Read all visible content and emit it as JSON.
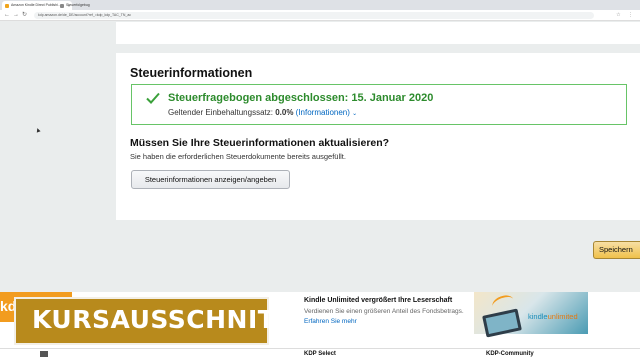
{
  "browser": {
    "tabs": [
      {
        "label": "Amazon Kindle Direct Publishi...",
        "active": true
      },
      {
        "label": "Steuerfolgebug"
      }
    ],
    "url": "kdp.amazon.de/de_DE/account?ref_=kdp_kdp_TAC_TN_ac"
  },
  "tax": {
    "section_title": "Steuerinformationen",
    "success_title": "Steuerfragebogen abgeschlossen: 15. Januar 2020",
    "rate_label": "Geltender Einbehaltungssatz:",
    "rate_value": "0.0%",
    "info_link": "(Informationen)",
    "question_title": "Müssen Sie Ihre Steuerinformationen aktualisieren?",
    "question_sub": "Sie haben die erforderlichen Steuerdokumente bereits ausgefüllt.",
    "button_label": "Steuerinformationen anzeigen/angeben"
  },
  "actions": {
    "save_label": "Speichern"
  },
  "promo": {
    "left_text": "kd",
    "ku_title": "Kindle Unlimited vergrößert Ihre Leserschaft",
    "ku_sub": "Verdienen Sie einen größeren Anteil des Fondsbetrags.",
    "ku_link": "Erfahren Sie mehr",
    "ku_logo_a": "kindle",
    "ku_logo_b": "unlimited"
  },
  "footer": {
    "kdp_select": "KDP Select",
    "kdp_community": "KDP-Community"
  },
  "overlay": {
    "badge_text": "KURSAUSSCHNITT"
  },
  "colors": {
    "success_green": "#2d8b2d",
    "success_border": "#67c467",
    "link_blue": "#0066c0",
    "save_button": "#f0c14b",
    "badge_gold": "#b88a1c"
  }
}
